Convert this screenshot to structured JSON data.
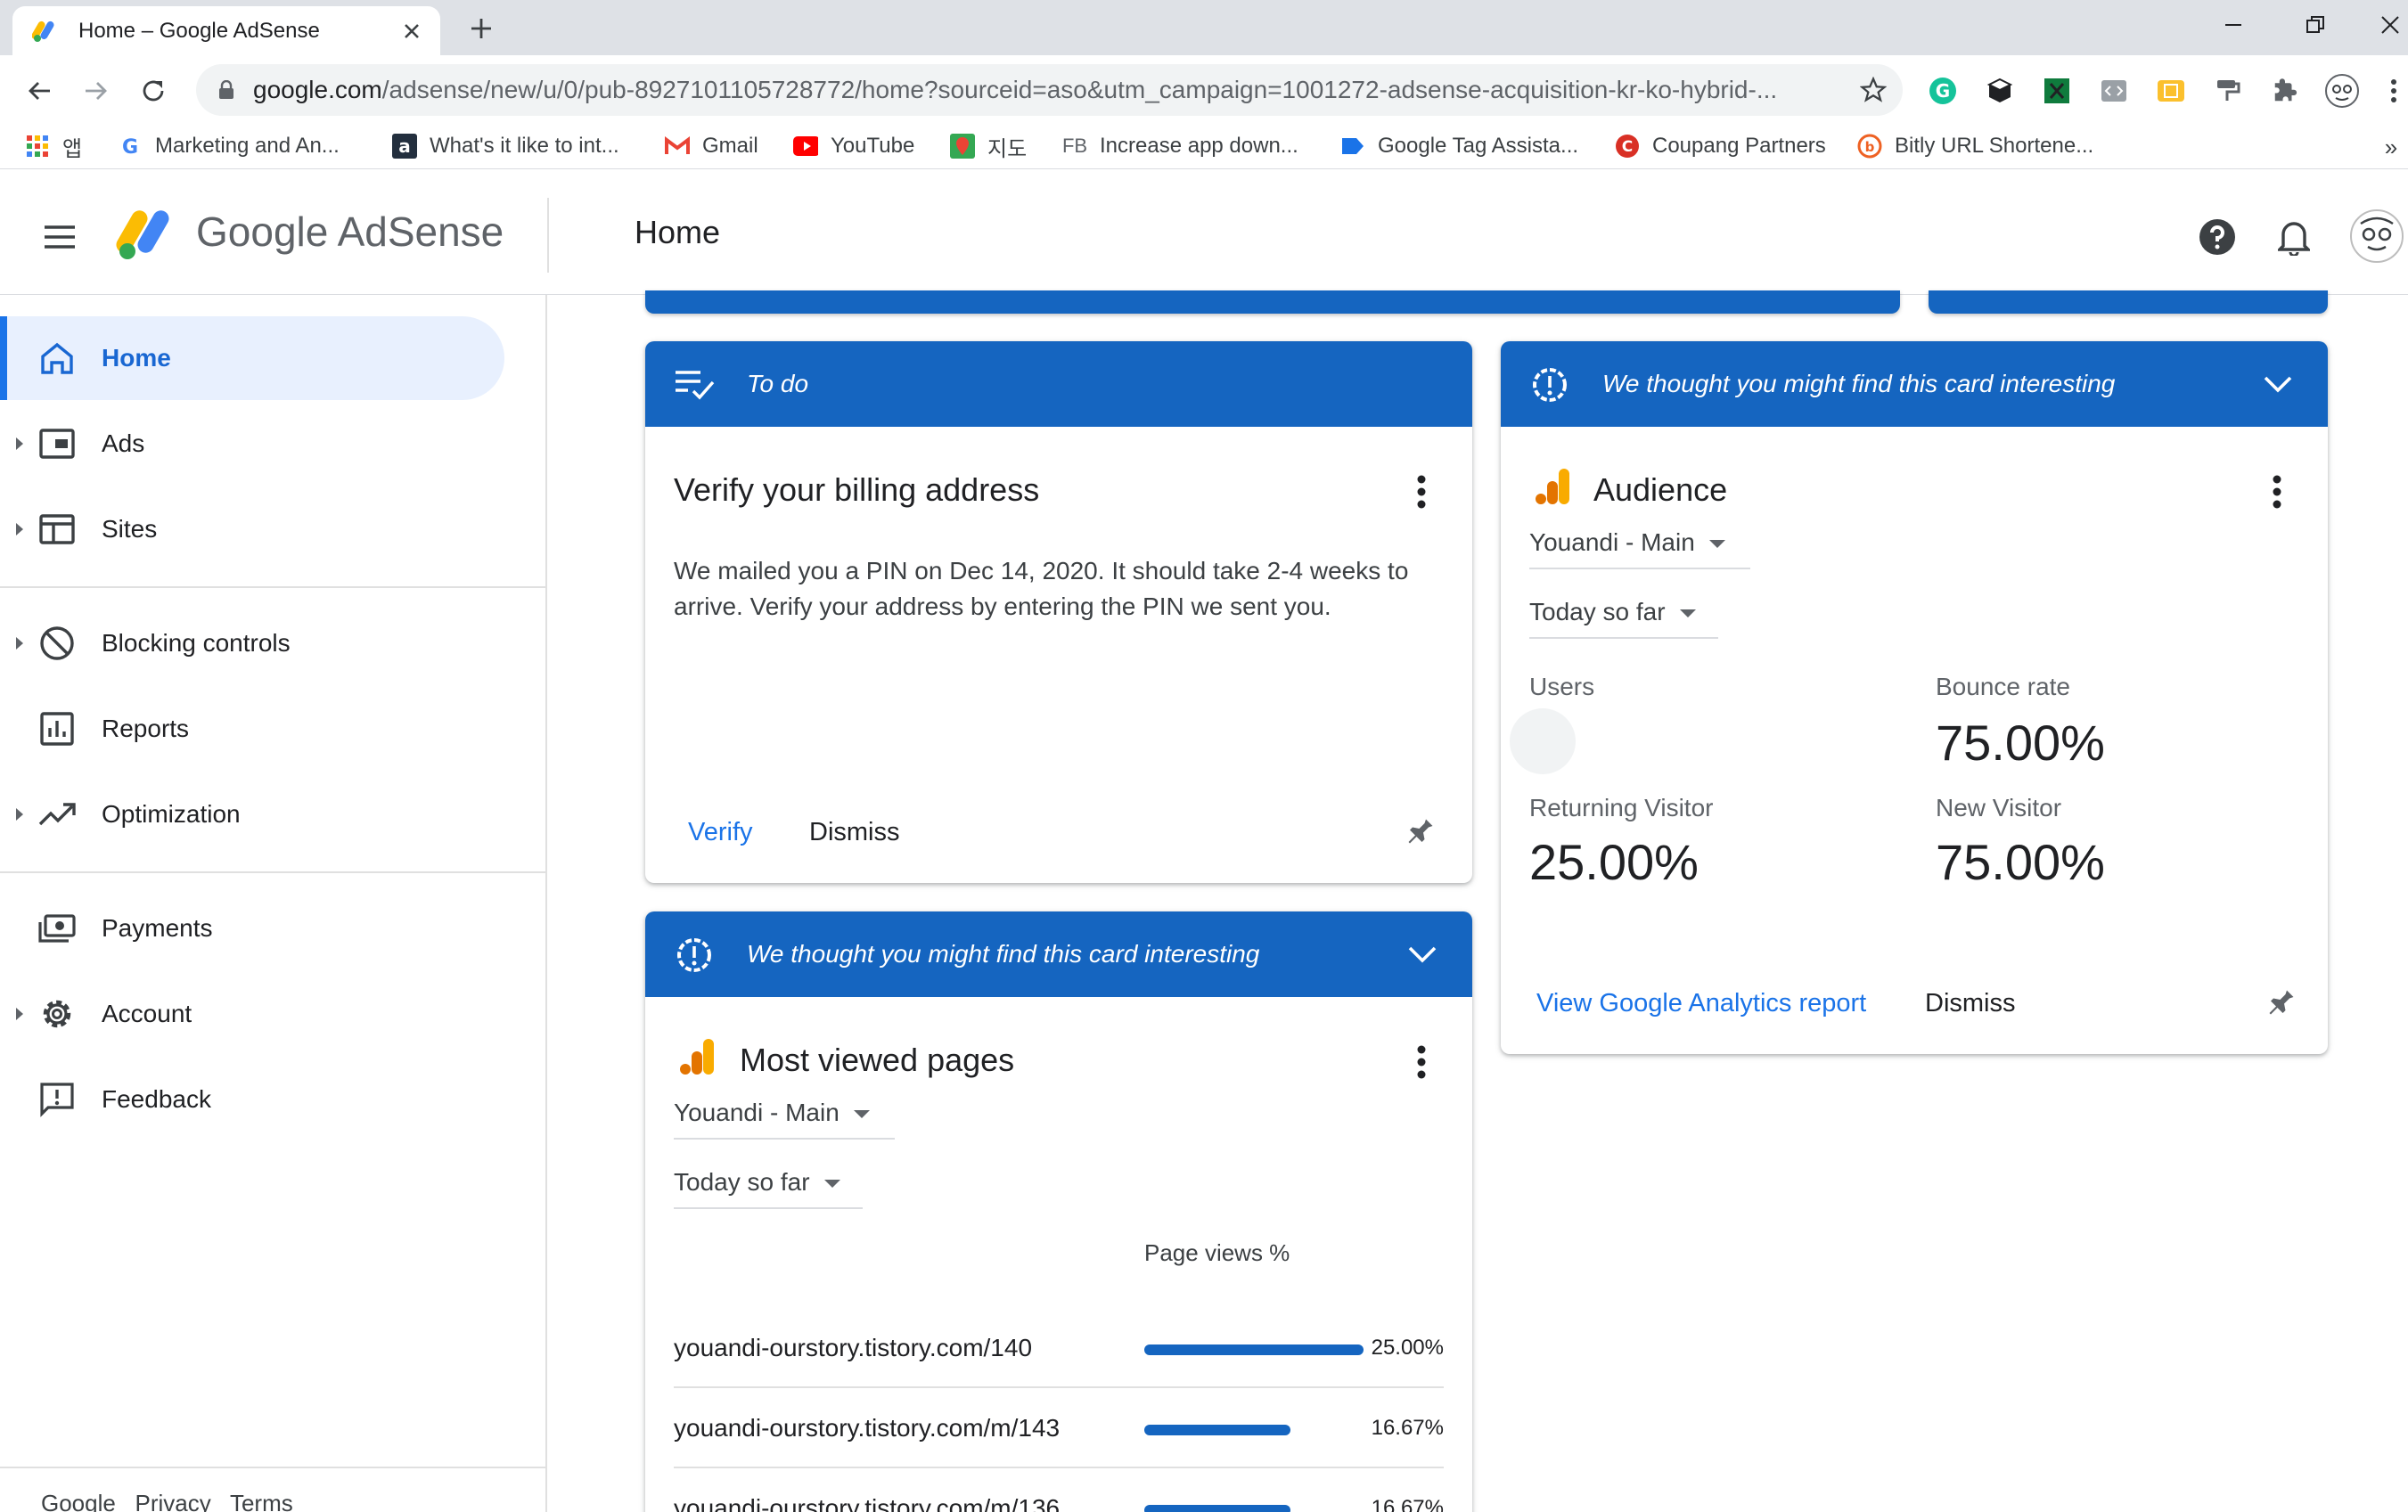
{
  "browser": {
    "tab_title": "Home – Google AdSense",
    "url_host": "google.com",
    "url_rest": "/adsense/new/u/0/pub-8927101105728772/home?sourceid=aso&utm_campaign=1001272-adsense-acquisition-kr-ko-hybrid-...",
    "bookmarks": [
      {
        "label": "앱",
        "icon": "apps-grid-icon"
      },
      {
        "label": "Marketing and An...",
        "icon": "google-g-icon"
      },
      {
        "label": "What's it like to int...",
        "icon": "amazon-a-icon"
      },
      {
        "label": "Gmail",
        "icon": "gmail-icon"
      },
      {
        "label": "YouTube",
        "icon": "youtube-icon"
      },
      {
        "label": "지도",
        "icon": "maps-icon"
      },
      {
        "label": "Increase app down...",
        "icon": "fb-text-icon",
        "icon_text": "FB"
      },
      {
        "label": "Google Tag Assista...",
        "icon": "tag-icon"
      },
      {
        "label": "Coupang Partners",
        "icon": "coupang-icon",
        "icon_text": "C"
      },
      {
        "label": "Bitly URL Shortene...",
        "icon": "bitly-icon",
        "icon_text": "b"
      }
    ]
  },
  "header": {
    "brand": "Google AdSense",
    "page_title": "Home"
  },
  "sidebar": {
    "items": [
      {
        "label": "Home",
        "icon": "home-icon",
        "active": true
      },
      {
        "label": "Ads",
        "icon": "ads-icon",
        "expandable": true
      },
      {
        "label": "Sites",
        "icon": "sites-icon",
        "expandable": true
      },
      {
        "label": "Blocking controls",
        "icon": "block-icon",
        "expandable": true
      },
      {
        "label": "Reports",
        "icon": "reports-icon"
      },
      {
        "label": "Optimization",
        "icon": "trending-icon",
        "expandable": true
      },
      {
        "label": "Payments",
        "icon": "payments-icon"
      },
      {
        "label": "Account",
        "icon": "gear-icon",
        "expandable": true
      },
      {
        "label": "Feedback",
        "icon": "feedback-icon"
      }
    ],
    "footer": [
      "Google",
      "Privacy",
      "Terms"
    ]
  },
  "todo_card": {
    "header": "To do",
    "title": "Verify your billing address",
    "body": "We mailed you a PIN on Dec 14, 2020. It should take 2-4 weeks to arrive. Verify your address by entering the PIN we sent you.",
    "primary_action": "Verify",
    "secondary_action": "Dismiss"
  },
  "pages_card": {
    "header": "We thought you might find this card interesting",
    "title": "Most viewed pages",
    "property": "Youandi - Main",
    "period": "Today so far",
    "column_label": "Page views %",
    "rows": [
      {
        "url": "youandi-ourstory.tistory.com/140",
        "percent": "25.00%",
        "fraction": 1.0
      },
      {
        "url": "youandi-ourstory.tistory.com/m/143",
        "percent": "16.67%",
        "fraction": 0.667
      },
      {
        "url": "youandi-ourstory.tistory.com/m/136",
        "percent": "16.67%",
        "fraction": 0.667
      }
    ]
  },
  "audience_card": {
    "header": "We thought you might find this card interesting",
    "title": "Audience",
    "property": "Youandi - Main",
    "period": "Today so far",
    "users_label": "Users",
    "bounce_label": "Bounce rate",
    "bounce_value": "75.00%",
    "returning_label": "Returning Visitor",
    "returning_value": "25.00%",
    "new_label": "New Visitor",
    "new_value": "75.00%",
    "primary_action": "View Google Analytics report",
    "secondary_action": "Dismiss"
  },
  "colors": {
    "card_header": "#1565c0",
    "accent": "#1a73e8",
    "active_nav_bg": "#e8f0fe"
  }
}
